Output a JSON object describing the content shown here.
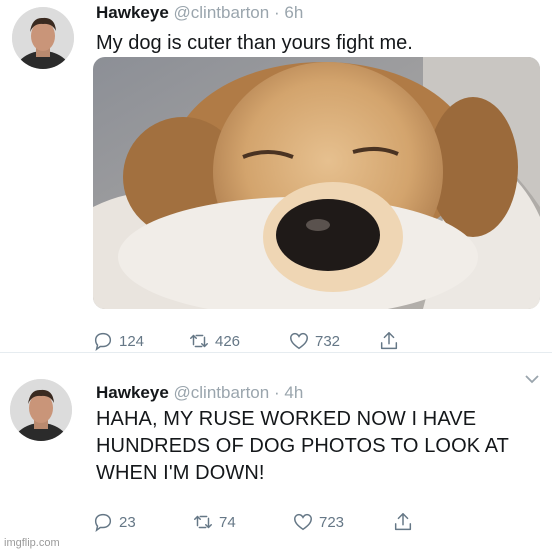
{
  "tweets": [
    {
      "name": "Hawkeye",
      "handle": "@clintbarton",
      "separator": "·",
      "time": "6h",
      "text": "My dog is cuter than yours fight me.",
      "counts": {
        "replies": "124",
        "retweets": "426",
        "likes": "732"
      }
    },
    {
      "name": "Hawkeye",
      "handle": "@clintbarton",
      "separator": "·",
      "time": "4h",
      "text": "HAHA, MY RUSE WORKED NOW I HAVE HUNDREDS OF DOG PHOTOS TO LOOK AT WHEN I'M DOWN!",
      "counts": {
        "replies": "23",
        "retweets": "74",
        "likes": "723"
      }
    }
  ],
  "icons": {
    "reply": "reply-icon",
    "retweet": "retweet-icon",
    "like": "like-icon",
    "share": "share-icon",
    "more": "chevron-down-icon"
  },
  "colors": {
    "text": "#14171a",
    "muted": "#9aa5ad",
    "action": "#657786"
  },
  "watermark": "imgflip.com"
}
